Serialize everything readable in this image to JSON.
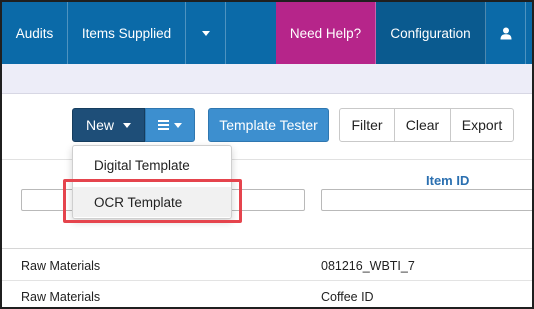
{
  "topnav": {
    "items": [
      {
        "label": "Audits"
      },
      {
        "label": "Items Supplied"
      },
      {
        "label": ""
      },
      {
        "label": "Need Help?"
      },
      {
        "label": "Configuration"
      }
    ],
    "colors": {
      "nav": "#0b6aa8",
      "help": "#b6258a",
      "config": "#0a5a8f"
    }
  },
  "toolbar": {
    "new_label": "New",
    "template_tester_label": "Template Tester",
    "filter_label": "Filter",
    "clear_label": "Clear",
    "export_label": "Export"
  },
  "dropdown": {
    "items": [
      {
        "label": "Digital Template"
      },
      {
        "label": "OCR Template"
      }
    ],
    "highlight_color": "#e5444d"
  },
  "grid": {
    "column_header": "Item ID",
    "filter_a_value": "",
    "filter_b_value": "",
    "rows": [
      {
        "col_a": "Raw Materials",
        "col_b": "081216_WBTI_7"
      },
      {
        "col_a": "Raw Materials",
        "col_b": "Coffee ID"
      }
    ]
  }
}
